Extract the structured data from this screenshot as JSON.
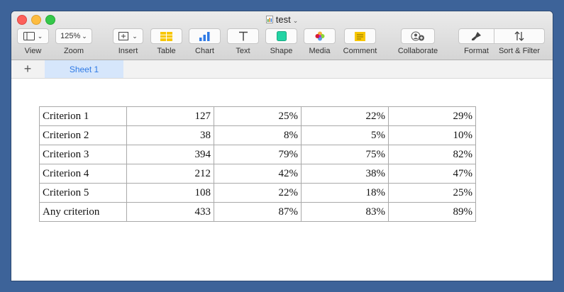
{
  "window": {
    "doc_title": "test",
    "doc_icon": "numbers-doc-icon"
  },
  "toolbar": {
    "view_label": "View",
    "zoom_value": "125%",
    "zoom_label": "Zoom",
    "insert_label": "Insert",
    "table_label": "Table",
    "chart_label": "Chart",
    "text_label": "Text",
    "shape_label": "Shape",
    "media_label": "Media",
    "comment_label": "Comment",
    "collaborate_label": "Collaborate",
    "format_label": "Format",
    "sort_filter_label": "Sort & Filter"
  },
  "tabs": {
    "add_sheet": "+",
    "active_sheet": "Sheet 1"
  },
  "table": {
    "rows": [
      [
        "Criterion 1",
        "127",
        "25%",
        "22%",
        "29%"
      ],
      [
        "Criterion 2",
        "38",
        "8%",
        "5%",
        "10%"
      ],
      [
        "Criterion 3",
        "394",
        "79%",
        "75%",
        "82%"
      ],
      [
        "Criterion 4",
        "212",
        "42%",
        "38%",
        "47%"
      ],
      [
        "Criterion 5",
        "108",
        "22%",
        "18%",
        "25%"
      ],
      [
        "Any criterion",
        "433",
        "87%",
        "83%",
        "89%"
      ]
    ]
  },
  "colors": {
    "desktop": "#3d6399",
    "accent": "#2f7ae5",
    "active_tab": "#d6e6fb"
  }
}
